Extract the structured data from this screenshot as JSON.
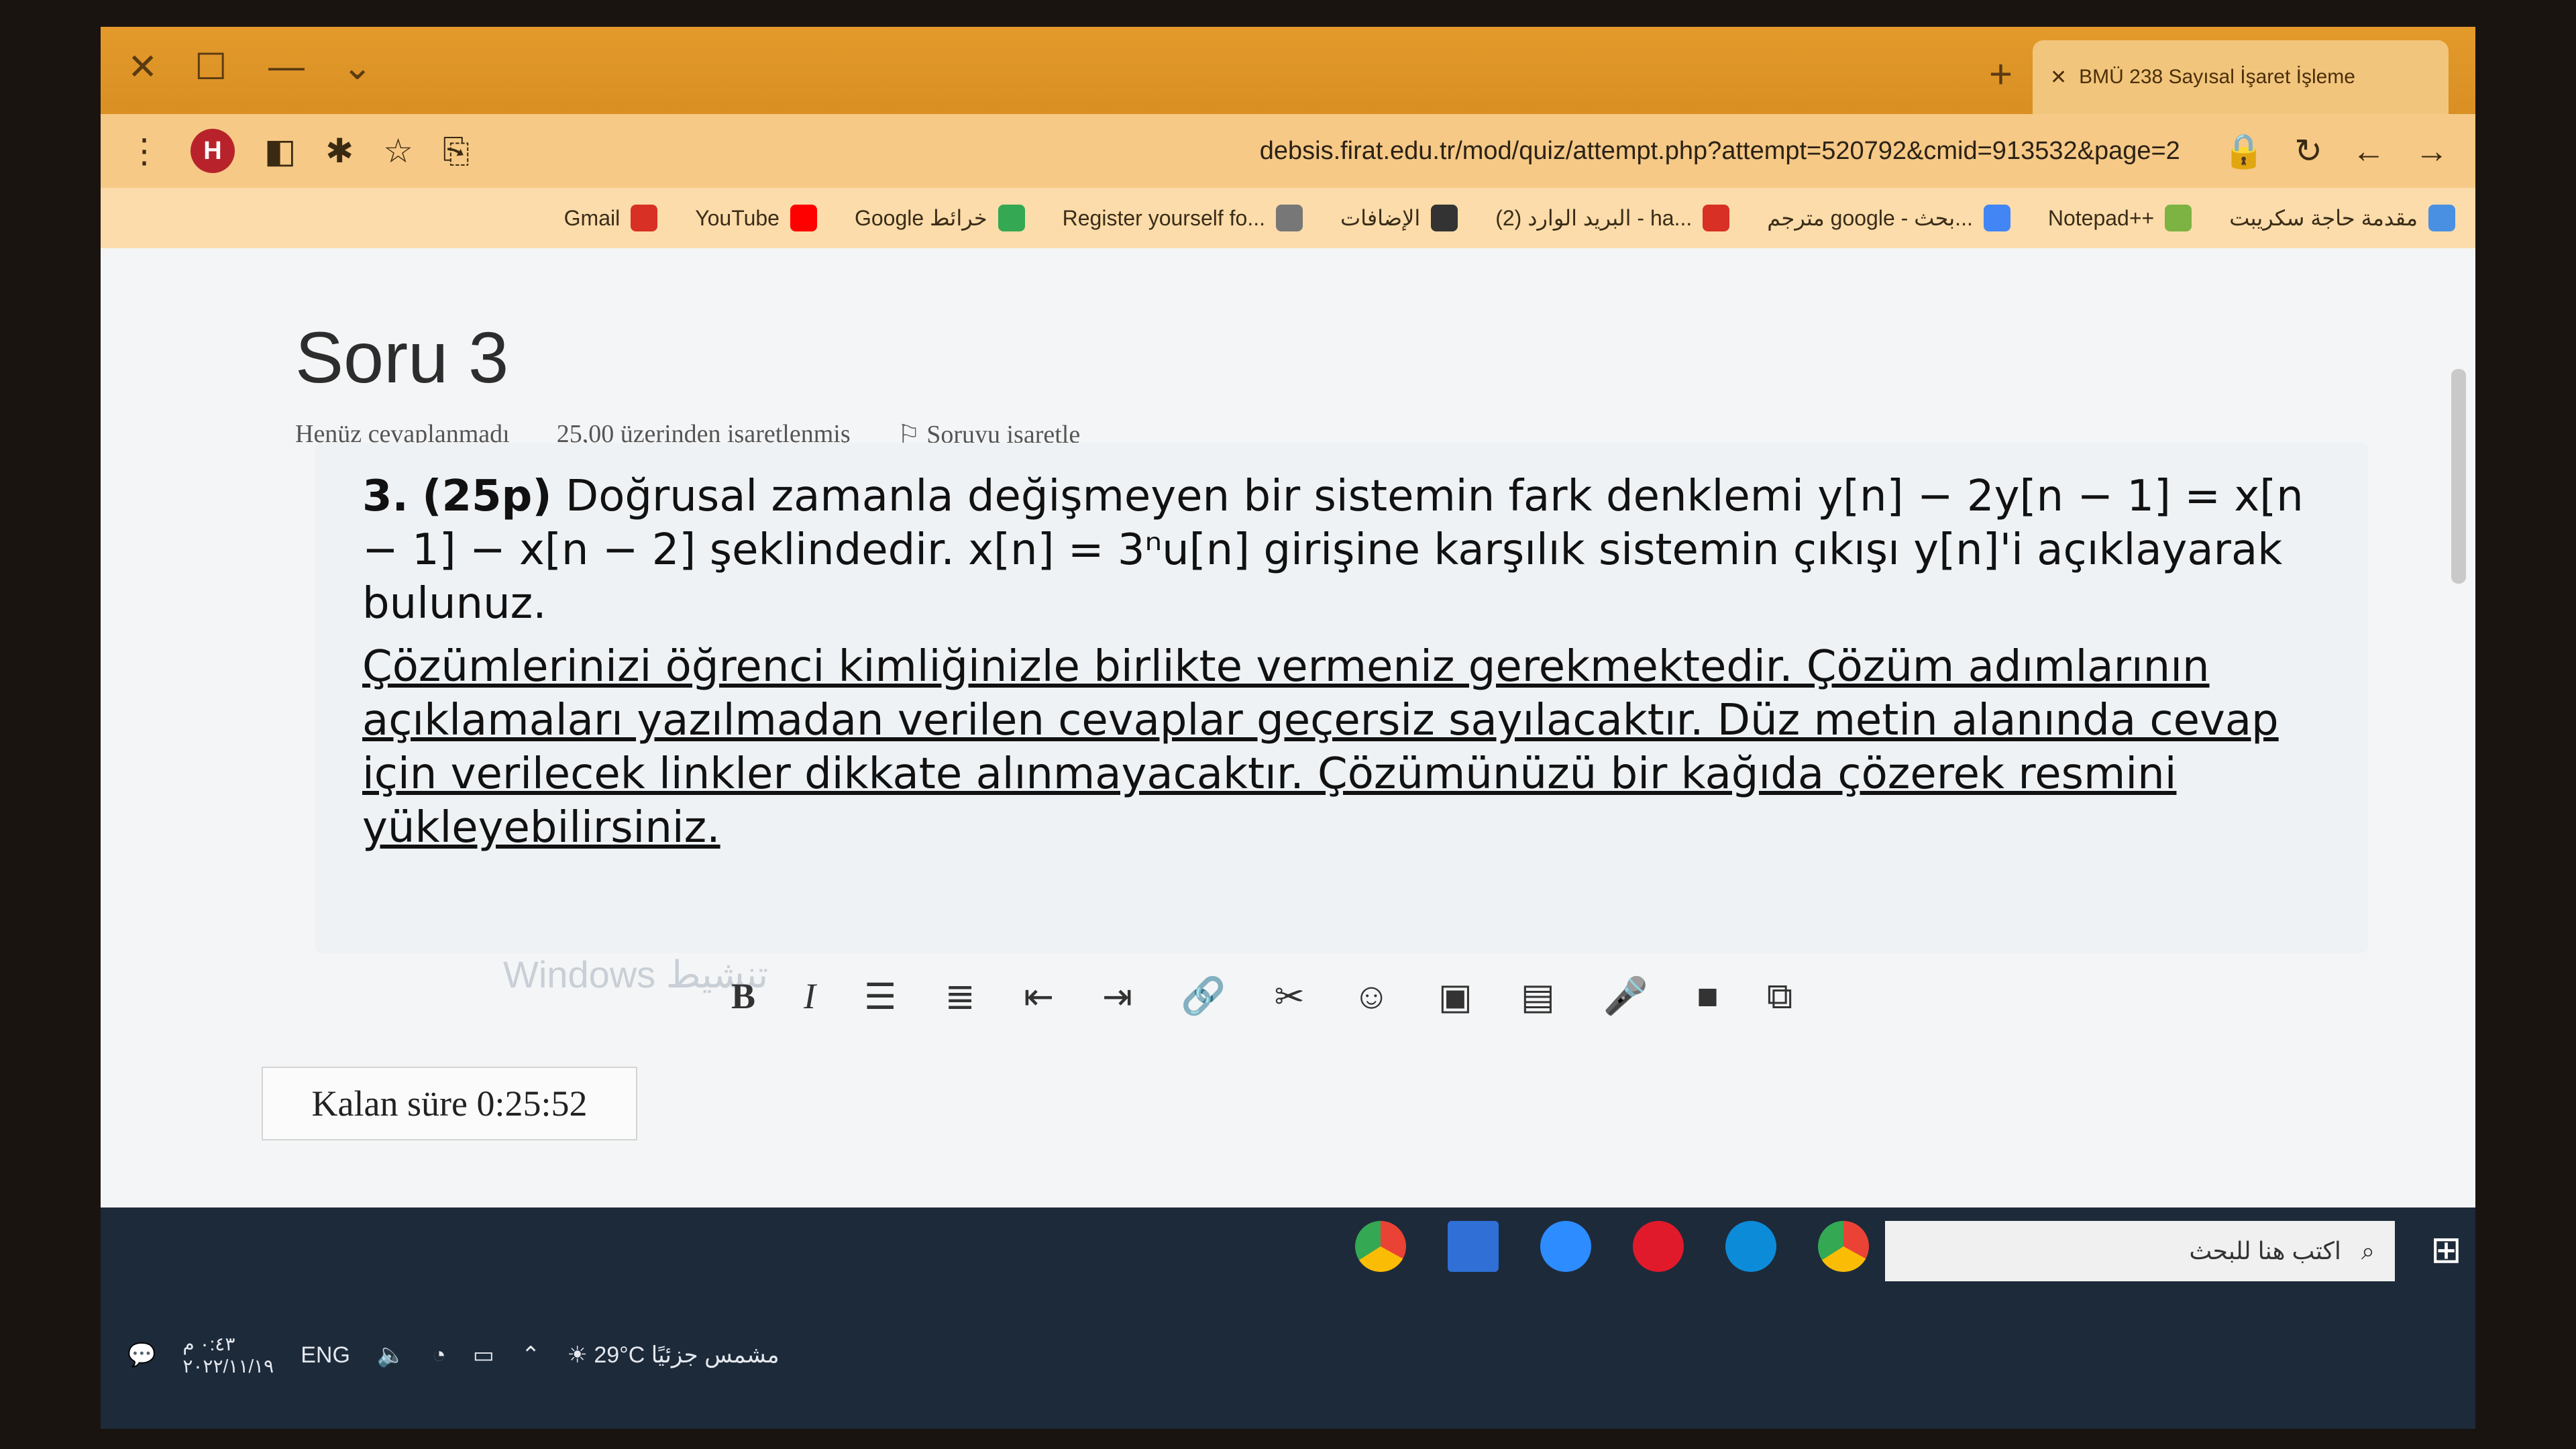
{
  "browser": {
    "tab_title": "BMÜ 238 Sayısal İşaret İşleme",
    "url": "debsis.firat.edu.tr/mod/quiz/attempt.php?attempt=520792&cmid=913532&page=2",
    "avatar_letter": "H"
  },
  "bookmarks": [
    {
      "label": "Gmail",
      "color": "#d93025"
    },
    {
      "label": "YouTube",
      "color": "#ff0000"
    },
    {
      "label": "Google خرائط",
      "color": "#34a853"
    },
    {
      "label": "Register yourself fo...",
      "color": "#777777"
    },
    {
      "label": "الإضافات",
      "color": "#333333"
    },
    {
      "label": "البريد الوارد (2) - ha...",
      "color": "#d93025"
    },
    {
      "label": "مترجم google - بحث...",
      "color": "#4285f4"
    },
    {
      "label": "Notepad++",
      "color": "#7cb342"
    },
    {
      "label": "مقدمة حاجة سكريبت",
      "color": "#4a90e2"
    }
  ],
  "question": {
    "title": "Soru 3",
    "status": "Henüz cevaplanmadı",
    "marks": "25,00 üzerinden işaretlenmiş",
    "flag": "Soruyu işaretle",
    "number": "3.",
    "points": "(25p)",
    "body_1": "Doğrusal zamanla değişmeyen bir sistemin fark denklemi y[n] − 2y[n − 1] = x[n − 1] − x[n − 2] şeklindedir. x[n] = 3ⁿu[n] girişine karşılık sistemin çıkışı y[n]'i açıklayarak bulunuz.",
    "body_2": "Çözümlerinizi öğrenci kimliğinizle birlikte vermeniz gerekmektedir. Çözüm adımlarının açıklamaları yazılmadan verilen cevaplar geçersiz sayılacaktır. Düz metin alanında cevap için verilecek linkler dikkate alınmayacaktır. Çözümünüzü bir kağıda çözerek resmini yükleyebilirsiniz."
  },
  "editor": {
    "bold": "B",
    "italic": "I",
    "watermark": "Windows تنشيط"
  },
  "timer": "Kalan süre 0:25:52",
  "taskbar": {
    "weather": "29°C مشمس جزئيًا",
    "lang": "ENG",
    "time": "٠:٤٣ م",
    "date": "٢٠٢٢/١١/١٩",
    "search_placeholder": "اكتب هنا للبحث"
  }
}
